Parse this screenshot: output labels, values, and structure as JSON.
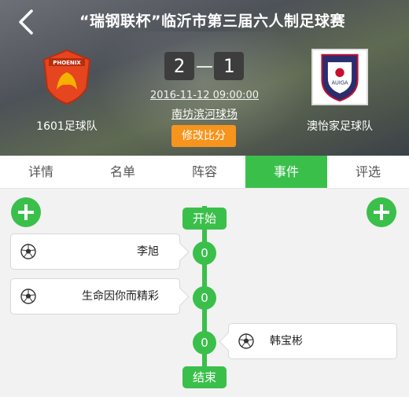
{
  "header": {
    "title": "“瑞钢联杯”临沂市第三届六人制足球赛",
    "home_team": "1601足球队",
    "away_team": "澳怡家足球队",
    "home_score": "2",
    "away_score": "1",
    "datetime": "2016-11-12 09:00:00",
    "venue": "南坊滨河球场",
    "edit_score_label": "修改比分",
    "home_logo_text": "PHOENIX",
    "away_logo_text": "AUIGA"
  },
  "tabs": [
    {
      "label": "详情"
    },
    {
      "label": "名单"
    },
    {
      "label": "阵容"
    },
    {
      "label": "事件",
      "active": true
    },
    {
      "label": "评选"
    }
  ],
  "timeline": {
    "start_label": "开始",
    "end_label": "结束",
    "events": [
      {
        "side": "home",
        "minute": "0",
        "player": "李旭",
        "icon": "soccer-ball-icon"
      },
      {
        "side": "home",
        "minute": "0",
        "player": "生命因你而精彩",
        "icon": "soccer-ball-icon"
      },
      {
        "side": "away",
        "minute": "0",
        "player": "韩宝彬",
        "icon": "soccer-ball-icon"
      }
    ]
  },
  "colors": {
    "accent": "#3bbf4b",
    "edit_button": "#f7941d"
  }
}
